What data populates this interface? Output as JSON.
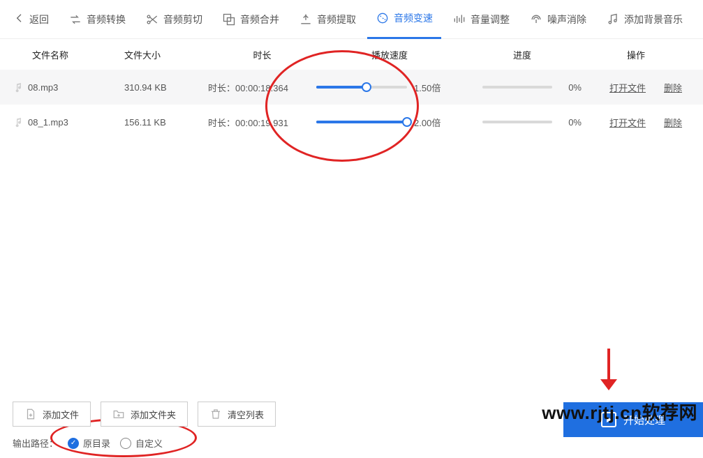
{
  "toolbar": {
    "back": "返回",
    "tabs": [
      {
        "id": "convert",
        "label": "音频转换"
      },
      {
        "id": "trim",
        "label": "音频剪切"
      },
      {
        "id": "merge",
        "label": "音频合并"
      },
      {
        "id": "extract",
        "label": "音频提取"
      },
      {
        "id": "speed",
        "label": "音频变速",
        "active": true
      },
      {
        "id": "volume",
        "label": "音量调整"
      },
      {
        "id": "denoise",
        "label": "噪声消除"
      },
      {
        "id": "bgm",
        "label": "添加背景音乐"
      }
    ]
  },
  "columns": {
    "name": "文件名称",
    "size": "文件大小",
    "duration": "时长",
    "speed": "播放速度",
    "progress": "进度",
    "ops": "操作"
  },
  "duration_prefix": "时长：",
  "speed_suffix": "倍",
  "rows": [
    {
      "name": "08.mp3",
      "size": "310.94 KB",
      "duration": "00:00:18.364",
      "speed_value": 1.5,
      "speed_label": "1.50",
      "slider_pct": 55,
      "progress_pct": "0%",
      "open": "打开文件",
      "del": "删除"
    },
    {
      "name": "08_1.mp3",
      "size": "156.11 KB",
      "duration": "00:00:19.931",
      "speed_value": 2.0,
      "speed_label": "2.00",
      "slider_pct": 100,
      "progress_pct": "0%",
      "open": "打开文件",
      "del": "删除"
    }
  ],
  "bottom": {
    "add_file": "添加文件",
    "add_folder": "添加文件夹",
    "clear": "清空列表",
    "start": "开始处理",
    "output_label": "输出路径：",
    "opt_original": "原目录",
    "opt_custom": "自定义",
    "selected": "original"
  },
  "watermark": "www.rjtj.cn软荐网"
}
